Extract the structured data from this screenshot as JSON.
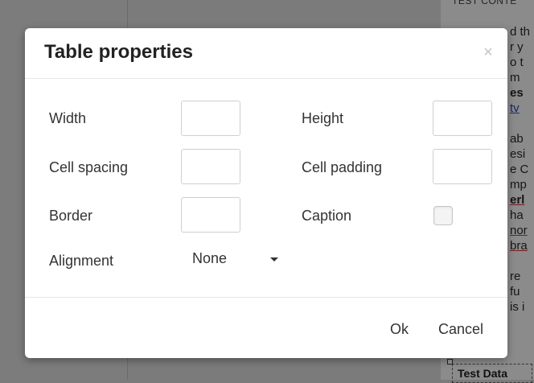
{
  "background": {
    "doc_heading": "TEST CONTE",
    "doc_lines": [
      "d th",
      "r y",
      "o t",
      "m",
      "es",
      "tv",
      "",
      "ab",
      "esi",
      "e C",
      "mp",
      "erl",
      "ha",
      "nor",
      "bra",
      "",
      "re",
      "fu",
      "is i"
    ],
    "test_data_label": "Test Data"
  },
  "dialog": {
    "title": "Table properties",
    "close_glyph": "×",
    "fields": {
      "width": {
        "label": "Width",
        "value": ""
      },
      "height": {
        "label": "Height",
        "value": ""
      },
      "cell_spacing": {
        "label": "Cell spacing",
        "value": ""
      },
      "cell_padding": {
        "label": "Cell padding",
        "value": ""
      },
      "border": {
        "label": "Border",
        "value": ""
      },
      "caption": {
        "label": "Caption",
        "checked": false
      },
      "alignment": {
        "label": "Alignment",
        "value": "None"
      }
    },
    "buttons": {
      "ok": "Ok",
      "cancel": "Cancel"
    }
  }
}
